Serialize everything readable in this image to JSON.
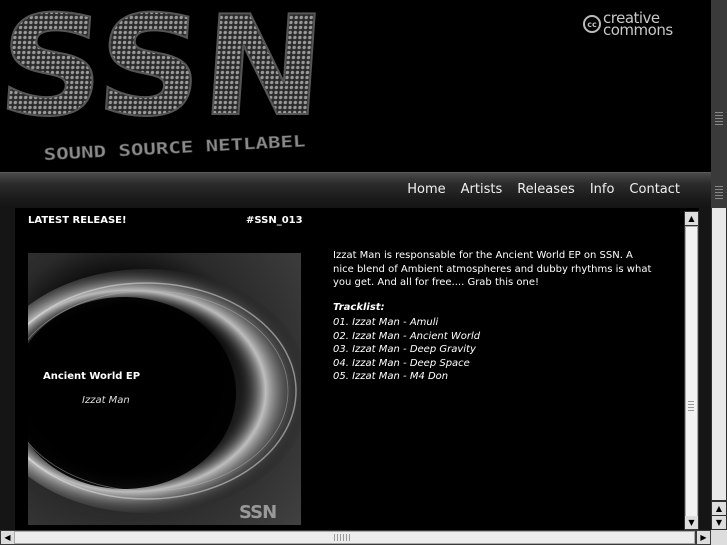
{
  "header": {
    "logo_text": "SSN",
    "logo_subtitle": "SOUND SOURCE NETLABEL",
    "cc_badge": "cc",
    "cc_text": "creative commons",
    "cc_icon": "creative-commons-icon"
  },
  "nav": {
    "items": [
      {
        "label": "Home"
      },
      {
        "label": "Artists"
      },
      {
        "label": "Releases"
      },
      {
        "label": "Info"
      },
      {
        "label": "Contact"
      }
    ]
  },
  "release": {
    "heading": "LATEST RELEASE!",
    "catalog": "#SSN_013",
    "cover": {
      "title": "Ancient World EP",
      "artist": "Izzat Man",
      "logo": "SSN"
    },
    "description": "Izzat Man is responsable for the Ancient World EP on SSN. A nice blend of Ambient atmospheres and dubby rhythms is what you get. And all for free.... Grab this one!",
    "tracklist_heading": "Tracklist:",
    "tracks": [
      "01. Izzat Man - Amuli",
      "02. Izzat Man - Ancient World",
      "03. Izzat Man - Deep Gravity",
      "04. Izzat Man - Deep Space",
      "05. Izzat Man - M4 Don"
    ]
  },
  "colors": {
    "background": "#000000",
    "text": "#ffffff",
    "nav_bar": "#2c2c2c"
  }
}
